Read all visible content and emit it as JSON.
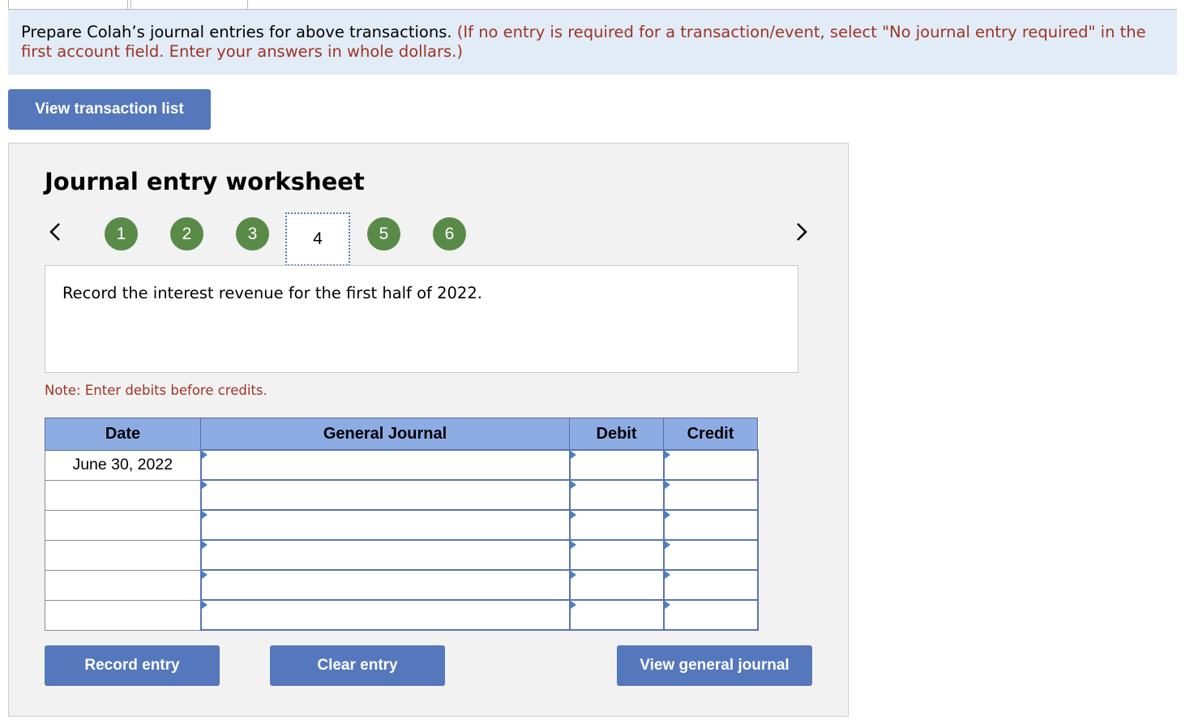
{
  "instructions": {
    "main": "Prepare Colah’s journal entries for above transactions.",
    "note": "(If no entry is required for a transaction/event, select \"No journal entry required\" in the first account field. Enter your answers in whole dollars.)"
  },
  "buttons": {
    "view_transaction_list": "View transaction list",
    "record_entry": "Record entry",
    "clear_entry": "Clear entry",
    "view_general_journal": "View general journal"
  },
  "worksheet": {
    "title": "Journal entry worksheet",
    "steps": [
      "1",
      "2",
      "3",
      "4",
      "5",
      "6"
    ],
    "active_step": "4",
    "description": "Record the interest revenue for the first half of 2022.",
    "note": "Note: Enter debits before credits."
  },
  "journal": {
    "headers": {
      "date": "Date",
      "general_journal": "General Journal",
      "debit": "Debit",
      "credit": "Credit"
    },
    "rows": [
      {
        "date": "June 30, 2022",
        "account": "",
        "debit": "",
        "credit": ""
      },
      {
        "date": "",
        "account": "",
        "debit": "",
        "credit": ""
      },
      {
        "date": "",
        "account": "",
        "debit": "",
        "credit": ""
      },
      {
        "date": "",
        "account": "",
        "debit": "",
        "credit": ""
      },
      {
        "date": "",
        "account": "",
        "debit": "",
        "credit": ""
      },
      {
        "date": "",
        "account": "",
        "debit": "",
        "credit": ""
      }
    ]
  },
  "colors": {
    "instruction_bg": "#e1ecf7",
    "accent_red": "#a03324",
    "button_blue": "#5577bb",
    "step_green": "#5a8a48",
    "table_header": "#8eace4"
  }
}
